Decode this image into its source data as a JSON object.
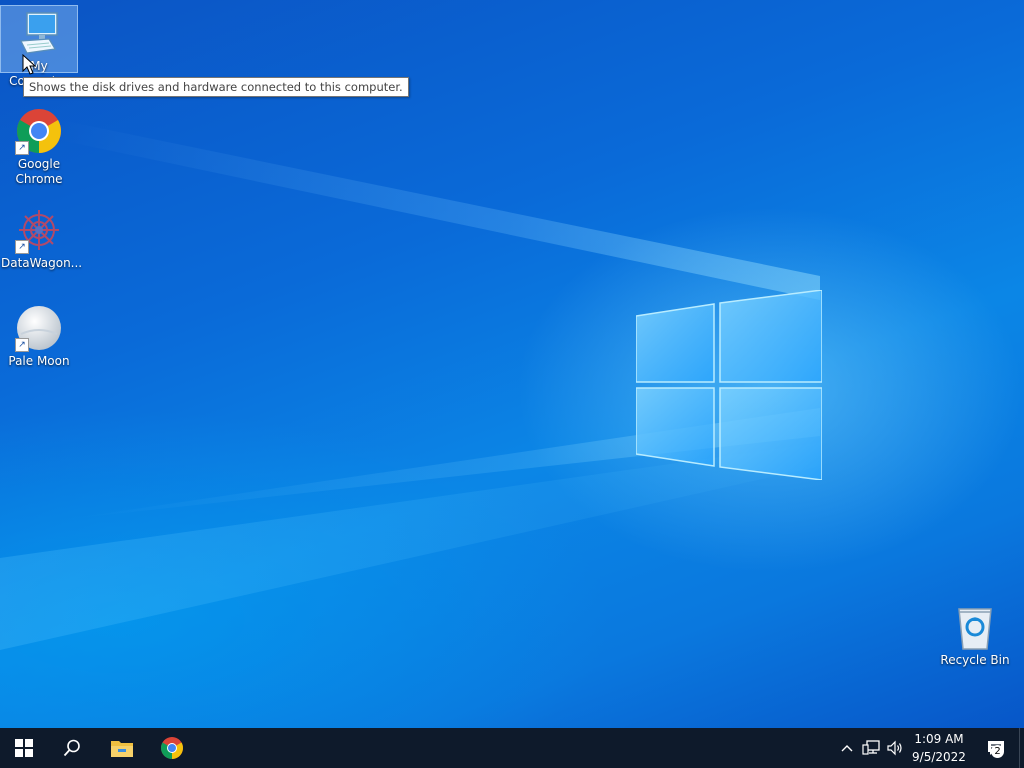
{
  "desktop": {
    "icons": [
      {
        "label": "My Computer",
        "icon": "computer-icon",
        "selected": true
      },
      {
        "label": "Google\nChrome",
        "icon": "chrome-icon",
        "shortcut": true
      },
      {
        "label": "DataWagon...",
        "icon": "datawagon-icon",
        "shortcut": true
      },
      {
        "label": "Pale Moon",
        "icon": "pale-moon-icon",
        "shortcut": true
      },
      {
        "label": "Recycle Bin",
        "icon": "recycle-bin-icon"
      }
    ],
    "tooltip": "Shows the disk drives and hardware connected to this computer."
  },
  "taskbar": {
    "start": "windows-start-icon",
    "search": "search-icon",
    "pinned": [
      "file-explorer-icon",
      "chrome-icon"
    ],
    "tray": {
      "icons": [
        "chevron-up-icon",
        "network-icon",
        "volume-icon"
      ],
      "time": "1:09 AM",
      "date": "9/5/2022",
      "notifications": "2"
    }
  },
  "colors": {
    "taskbar": "#0e1a2b",
    "desktop_blue": "#0a6ad8"
  }
}
